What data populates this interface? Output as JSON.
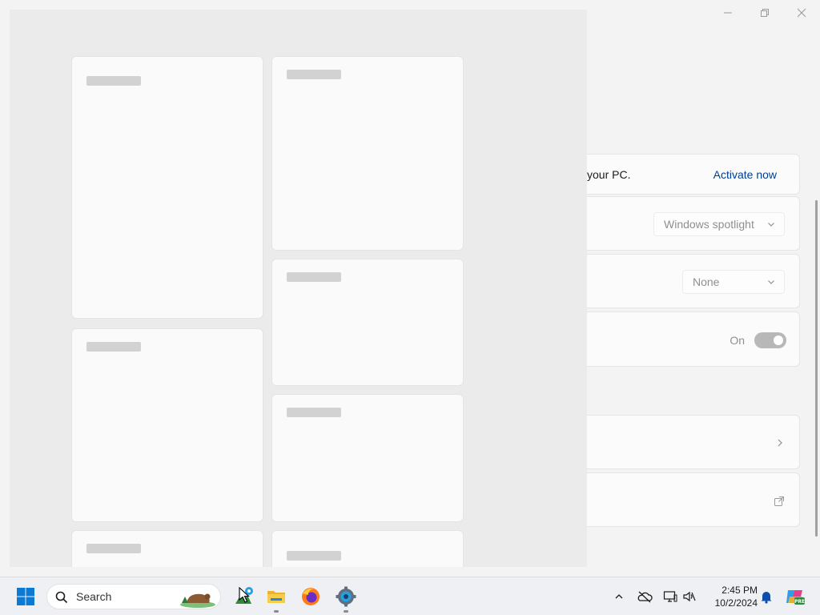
{
  "window": {
    "controls": {
      "minimize_icon": "minimize-icon",
      "restore_icon": "restore-icon",
      "close_icon": "close-icon"
    },
    "activation": {
      "text": "your PC.",
      "link": "Activate now"
    },
    "background_row": {
      "dropdown_value": "Windows spotlight"
    },
    "theme_row": {
      "dropdown_value": "None"
    },
    "toggle_row": {
      "label": "On",
      "state": true
    },
    "nav_row": {
      "icon": "chevron-right-icon"
    },
    "external_row": {
      "icon": "external-link-icon"
    }
  },
  "taskbar": {
    "search_placeholder": "Search",
    "clock": {
      "time": "2:45 PM",
      "date": "10/2/2024"
    },
    "apps": [
      "start-icon",
      "search-icon",
      "copilot-icon",
      "file-explorer-icon",
      "firefox-icon",
      "settings-icon"
    ],
    "tray": [
      "chevron-up-icon",
      "onedrive-offline-icon",
      "network-icon",
      "speaker-icon",
      "notification-bell-icon",
      "copilot-pre-icon"
    ]
  },
  "colors": {
    "accent": "#0067c0",
    "link": "#003e92",
    "taskbar_bg": "#eef0f3",
    "overlay_bg": "#ebebeb"
  }
}
